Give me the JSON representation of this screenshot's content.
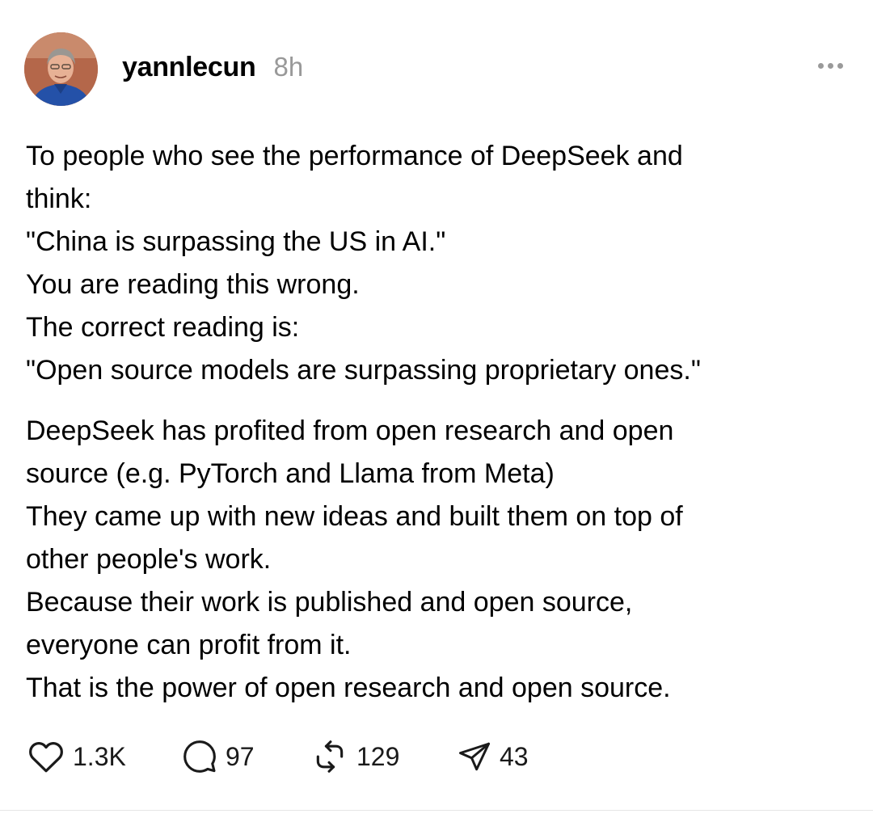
{
  "post": {
    "username": "yannlecun",
    "time": "8h",
    "body": {
      "paragraph1": [
        "To people who see the performance of DeepSeek and",
        "think:",
        "\"China is surpassing the US in AI.\"",
        "You are reading this wrong.",
        "The correct reading is:",
        "\"Open source models are surpassing proprietary ones.\""
      ],
      "paragraph2": [
        "DeepSeek has profited from open research and open",
        "source (e.g. PyTorch and Llama from Meta)",
        "They came up with new ideas and built them on top of",
        "other people's work.",
        "Because their work is published and open source,",
        "everyone can profit from it.",
        "That is the power of open research and open source."
      ]
    },
    "actions": {
      "likes": "1.3K",
      "replies": "97",
      "reposts": "129",
      "shares": "43"
    }
  },
  "icons": {
    "like": "heart-icon",
    "reply": "comment-bubble-icon",
    "repost": "repost-icon",
    "share": "send-icon",
    "more": "more-dots-icon"
  },
  "colors": {
    "text": "#000000",
    "muted": "#999999",
    "icon": "#1a1a1a"
  }
}
